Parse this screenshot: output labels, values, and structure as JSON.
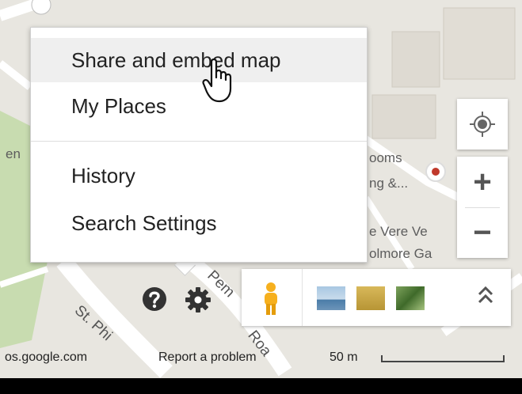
{
  "menu": {
    "items": [
      "Share and embed map",
      "My Places",
      "History",
      "Search Settings"
    ]
  },
  "map": {
    "labels": [
      "ooms",
      "ng &...",
      "e Vere Ve",
      "olmore Ga",
      "en"
    ],
    "streets": [
      "St. Phi",
      "Pem",
      "Roa"
    ]
  },
  "zoom": {
    "in_label": "+",
    "out_label": "−"
  },
  "footer": {
    "domain": "os.google.com",
    "report": "Report a problem",
    "scale": "50 m"
  },
  "icons": {
    "help": "help-icon",
    "settings": "gear-icon",
    "pegman": "pegman-icon",
    "locate": "my-location-icon",
    "expand": "chevron-up-icon"
  },
  "colors": {
    "map_bg": "#e8e6e0",
    "park": "#c8dcb0",
    "road": "#ffffff",
    "pegman": "#f6b01e",
    "poi": "#c0392b"
  }
}
